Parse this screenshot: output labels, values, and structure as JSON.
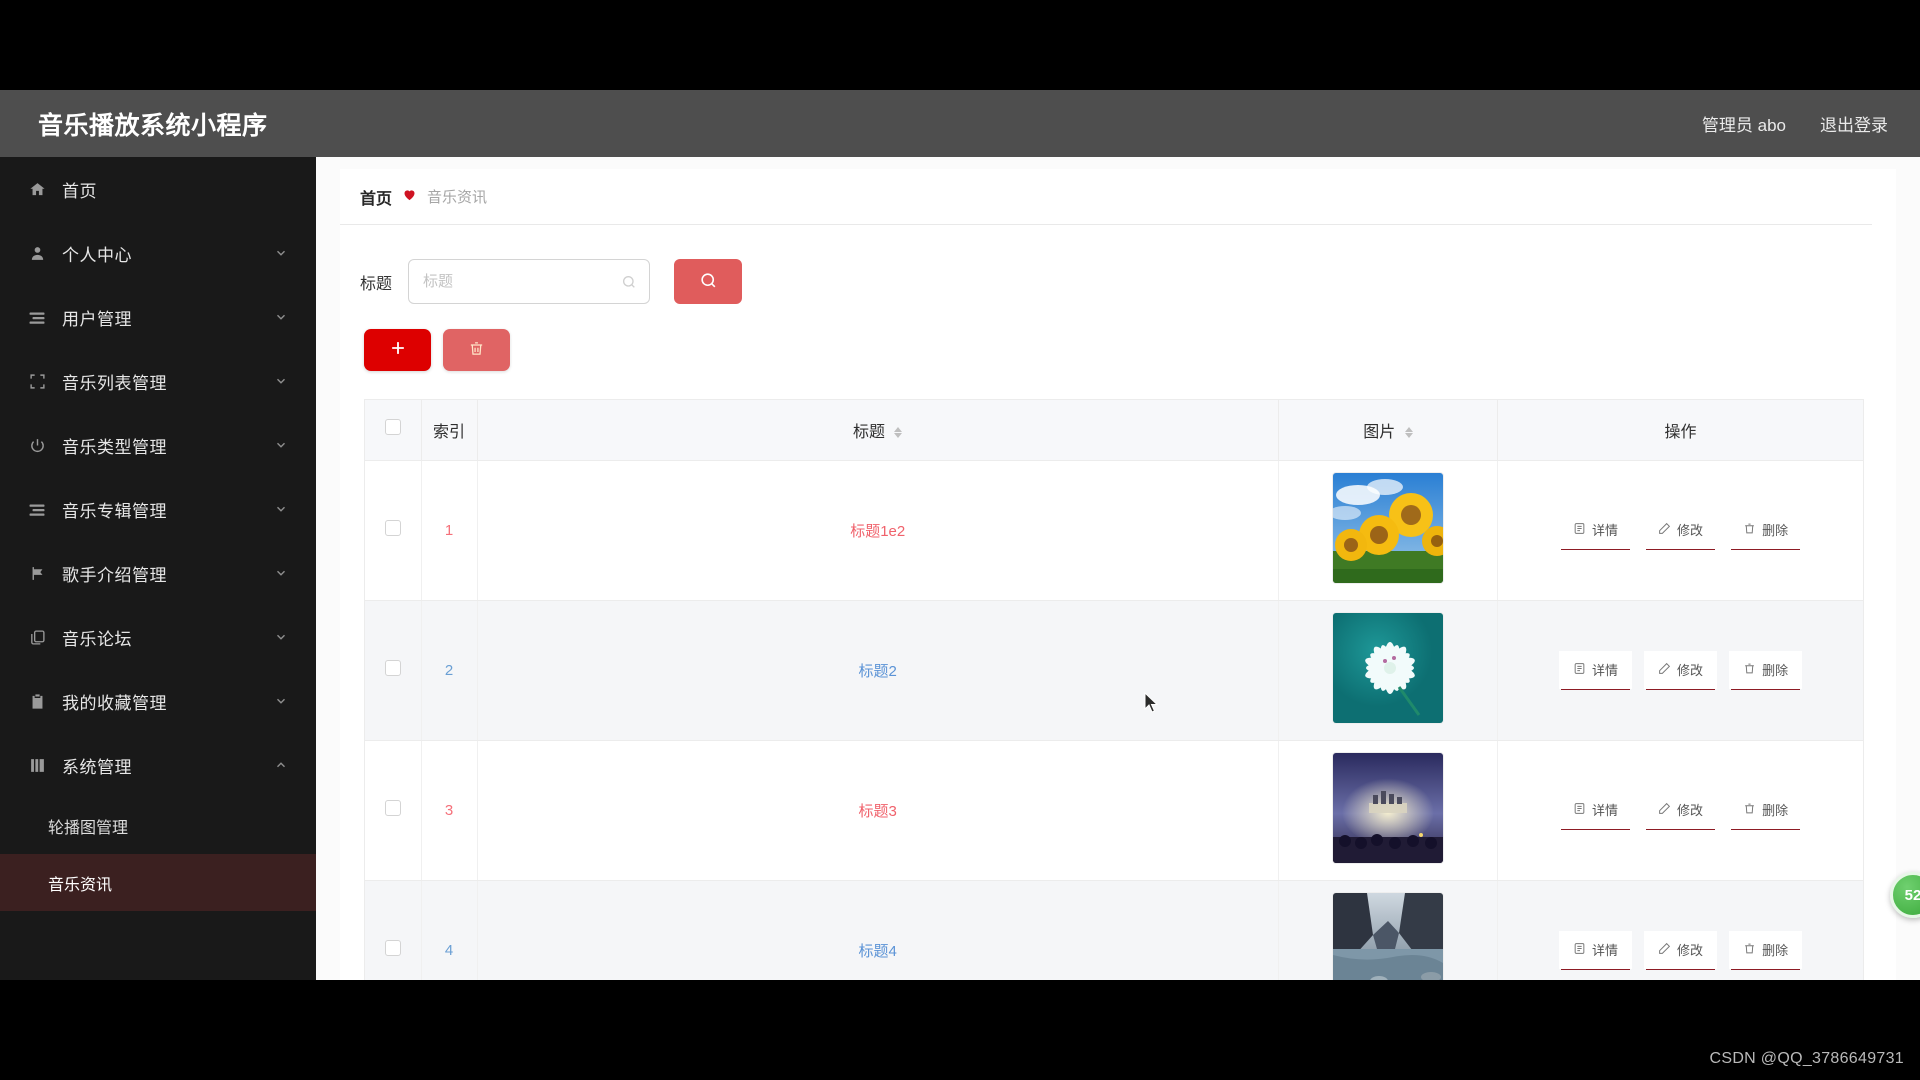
{
  "header": {
    "title": "音乐播放系统小程序",
    "admin_label": "管理员 abo",
    "logout_label": "退出登录"
  },
  "sidebar": {
    "items": [
      {
        "label": "首页",
        "icon": "home-icon",
        "expandable": false
      },
      {
        "label": "个人中心",
        "icon": "user-icon",
        "expandable": true
      },
      {
        "label": "用户管理",
        "icon": "list-icon",
        "expandable": true
      },
      {
        "label": "音乐列表管理",
        "icon": "crop-icon",
        "expandable": true
      },
      {
        "label": "音乐类型管理",
        "icon": "power-icon",
        "expandable": true
      },
      {
        "label": "音乐专辑管理",
        "icon": "list-icon",
        "expandable": true
      },
      {
        "label": "歌手介绍管理",
        "icon": "flag-icon",
        "expandable": true
      },
      {
        "label": "音乐论坛",
        "icon": "copy-icon",
        "expandable": true
      },
      {
        "label": "我的收藏管理",
        "icon": "clipboard-check-icon",
        "expandable": true
      },
      {
        "label": "系统管理",
        "icon": "book-icon",
        "expandable": true,
        "expanded": true
      }
    ],
    "submenu": [
      {
        "label": "轮播图管理",
        "active": false
      },
      {
        "label": "音乐资讯",
        "active": true
      }
    ]
  },
  "breadcrumb": {
    "home": "首页",
    "separator_icon": "heart-icon",
    "current": "音乐资讯"
  },
  "search": {
    "label": "标题",
    "placeholder": "标题",
    "value": "",
    "input_icon": "search-icon",
    "button_icon": "search-icon"
  },
  "toolbar": {
    "add_icon": "plus-icon",
    "add_label": "+",
    "delete_icon": "trash-icon"
  },
  "table": {
    "columns": [
      {
        "key": "checkbox",
        "label": "",
        "sortable": false
      },
      {
        "key": "index",
        "label": "索引",
        "sortable": false
      },
      {
        "key": "title",
        "label": "标题",
        "sortable": true
      },
      {
        "key": "image",
        "label": "图片",
        "sortable": true
      },
      {
        "key": "action",
        "label": "操作",
        "sortable": false
      }
    ],
    "rows": [
      {
        "index": "1",
        "title": "标题1e2",
        "color": "red",
        "image": "sunflowers-thumbnail"
      },
      {
        "index": "2",
        "title": "标题2",
        "color": "blue",
        "image": "white-flower-teal-thumbnail"
      },
      {
        "index": "3",
        "title": "标题3",
        "color": "red",
        "image": "concert-stage-thumbnail"
      },
      {
        "index": "4",
        "title": "标题4",
        "color": "blue",
        "image": "canyon-river-thumbnail"
      }
    ],
    "row_actions": [
      {
        "label": "详情",
        "icon": "detail-icon"
      },
      {
        "label": "修改",
        "icon": "edit-icon"
      },
      {
        "label": "删除",
        "icon": "trash-icon"
      }
    ]
  },
  "floating": {
    "badge_text": "52"
  },
  "watermark": {
    "text": "CSDN @QQ_3786649731"
  },
  "colors": {
    "header_bg": "#4e4e4e",
    "sidebar_bg": "#191919",
    "sidebar_active_bg": "#3b2020",
    "accent_red": "#dd0000",
    "search_btn": "#e05c5c",
    "delete_btn": "#e06464",
    "title_red": "#f0626c",
    "title_blue": "#5b93d6",
    "op_underline": "#8d1b24",
    "badge_green": "#3aa93a"
  }
}
